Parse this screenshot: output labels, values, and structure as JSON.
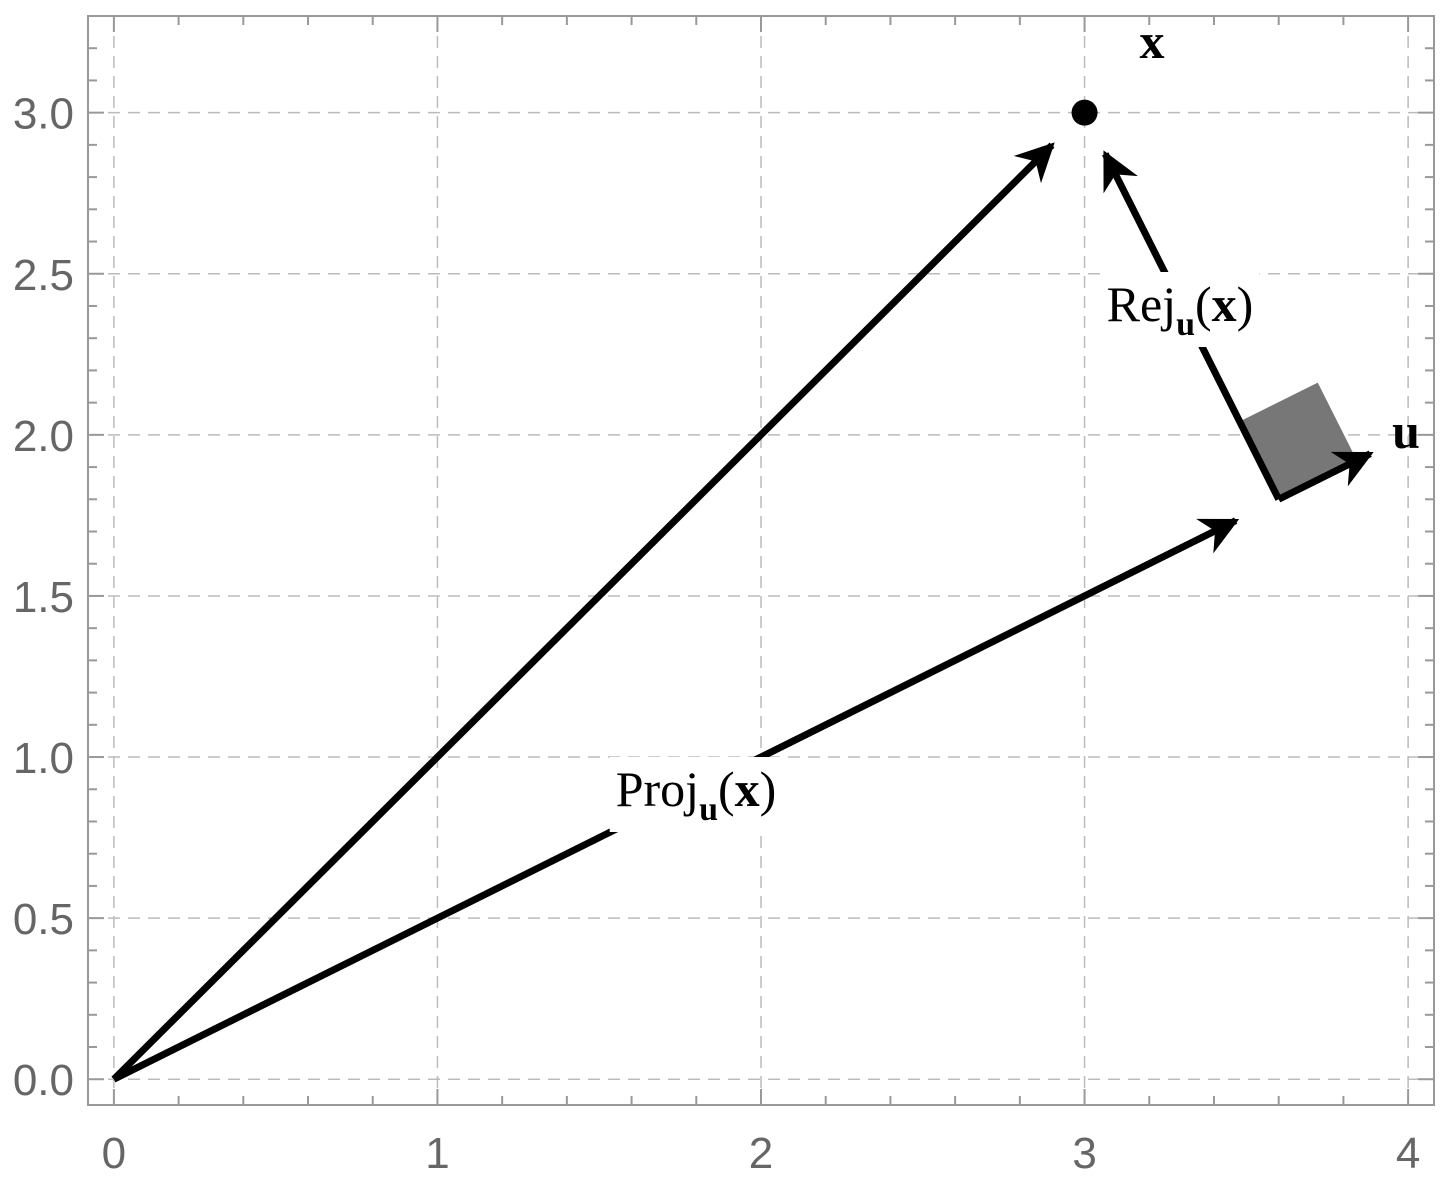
{
  "chart_data": {
    "type": "vector-diagram",
    "title": "",
    "xlabel": "",
    "ylabel": "",
    "xlim": [
      -0.08,
      4.08
    ],
    "ylim": [
      -0.08,
      3.3
    ],
    "grid": true,
    "grid_style": "dashed",
    "x_ticks": [
      "0",
      "1",
      "2",
      "3",
      "4"
    ],
    "y_ticks": [
      "0.0",
      "0.5",
      "1.0",
      "1.5",
      "2.0",
      "2.5",
      "3.0"
    ],
    "x_tick_values": [
      0,
      1,
      2,
      3,
      4
    ],
    "y_tick_values": [
      0,
      0.5,
      1.0,
      1.5,
      2.0,
      2.5,
      3.0
    ],
    "point": {
      "label": "x",
      "value": [
        3,
        3
      ]
    },
    "vectors": [
      {
        "name": "x-vector",
        "from": [
          0,
          0
        ],
        "to": [
          3,
          3
        ]
      },
      {
        "name": "projection",
        "from": [
          0,
          0
        ],
        "to": [
          3.6,
          1.8
        ],
        "label_main": "Proj",
        "label_sub": "u",
        "label_arg": "x"
      },
      {
        "name": "rejection",
        "from": [
          3.6,
          1.8
        ],
        "to": [
          3,
          3
        ],
        "label_main": "Rej",
        "label_sub": "u",
        "label_arg": "x"
      },
      {
        "name": "u-vector",
        "from": [
          3.6,
          1.8
        ],
        "to": [
          3.894,
          1.947
        ],
        "label": "u"
      }
    ],
    "right_angle_marker_color": "#777777",
    "arrow_color": "#000000"
  }
}
